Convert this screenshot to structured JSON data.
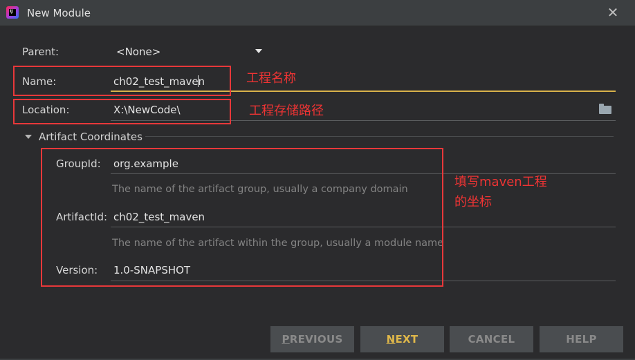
{
  "window": {
    "title": "New Module",
    "close_glyph": "✕",
    "app_icon": "intellij-idea-icon"
  },
  "form": {
    "parent": {
      "label": "Parent:",
      "value": "<None>"
    },
    "name": {
      "label": "Name:",
      "value": "ch02_test_maven"
    },
    "location": {
      "label": "Location:",
      "value": "X:\\NewCode\\"
    },
    "artifact_section": {
      "label": "Artifact Coordinates"
    },
    "group_id": {
      "label": "GroupId:",
      "value": "org.example",
      "hint": "The name of the artifact group, usually a company domain"
    },
    "artifact_id": {
      "label": "ArtifactId:",
      "value": "ch02_test_maven",
      "hint": "The name of the artifact within the group, usually a module name"
    },
    "version": {
      "label": "Version:",
      "value": "1.0-SNAPSHOT"
    }
  },
  "annotations": {
    "name_note": "工程名称",
    "location_note": "工程存储路径",
    "coords_note_line1": "填写maven工程",
    "coords_note_line2": "的坐标"
  },
  "buttons": {
    "previous": {
      "first": "P",
      "rest": "REVIOUS"
    },
    "next": {
      "first": "N",
      "rest": "EXT"
    },
    "cancel": "CANCEL",
    "help": "HELP"
  },
  "colors": {
    "background": "#2b2b2d",
    "focus_accent": "#d9b24a",
    "annotation_red": "#e8383a",
    "next_text": "#e0b84a",
    "disabled_text": "#8a8a8a"
  }
}
